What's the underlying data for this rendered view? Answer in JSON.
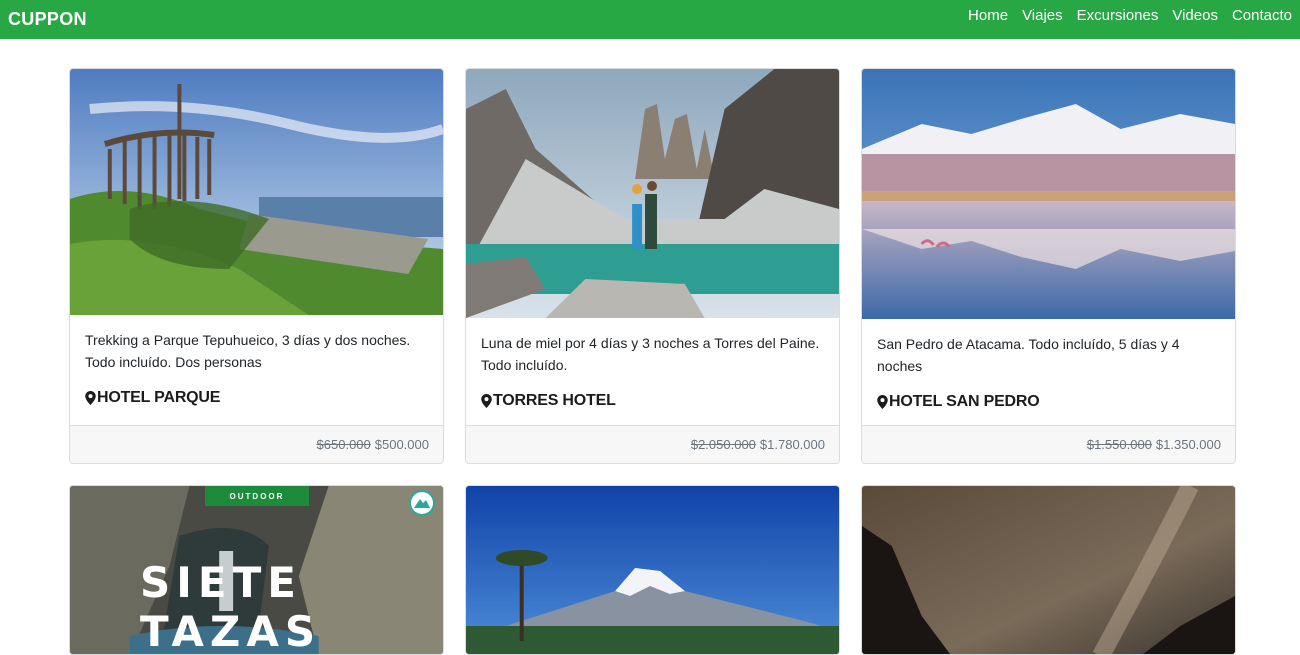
{
  "nav": {
    "brand": "CUPPON",
    "links": [
      "Home",
      "Viajes",
      "Excursiones",
      "Videos",
      "Contacto"
    ]
  },
  "cards": [
    {
      "description": "Trekking a Parque Tepuhueico, 3 días y dos noches. Todo incluído. Dos personas",
      "hotel": "HOTEL PARQUE",
      "old_price": "$650.000",
      "price": "$500.000"
    },
    {
      "description": "Luna de miel por 4 días y 3 noches a Torres del Paine. Todo incluído.",
      "hotel": "TORRES HOTEL",
      "old_price": "$2.050.000",
      "price": "$1.780.000"
    },
    {
      "description": "San Pedro de Atacama. Todo incluído, 5 días y 4 noches",
      "hotel": "HOTEL SAN PEDRO",
      "old_price": "$1.550.000",
      "price": "$1.350.000"
    }
  ],
  "second_row": {
    "badge": "OUTDOOR",
    "overlay_title": "SIETE TAZAS"
  },
  "colors": {
    "navbar": "#28a745",
    "footer_bg": "#f7f7f7"
  },
  "icons": {
    "location": "map-marker-icon"
  }
}
